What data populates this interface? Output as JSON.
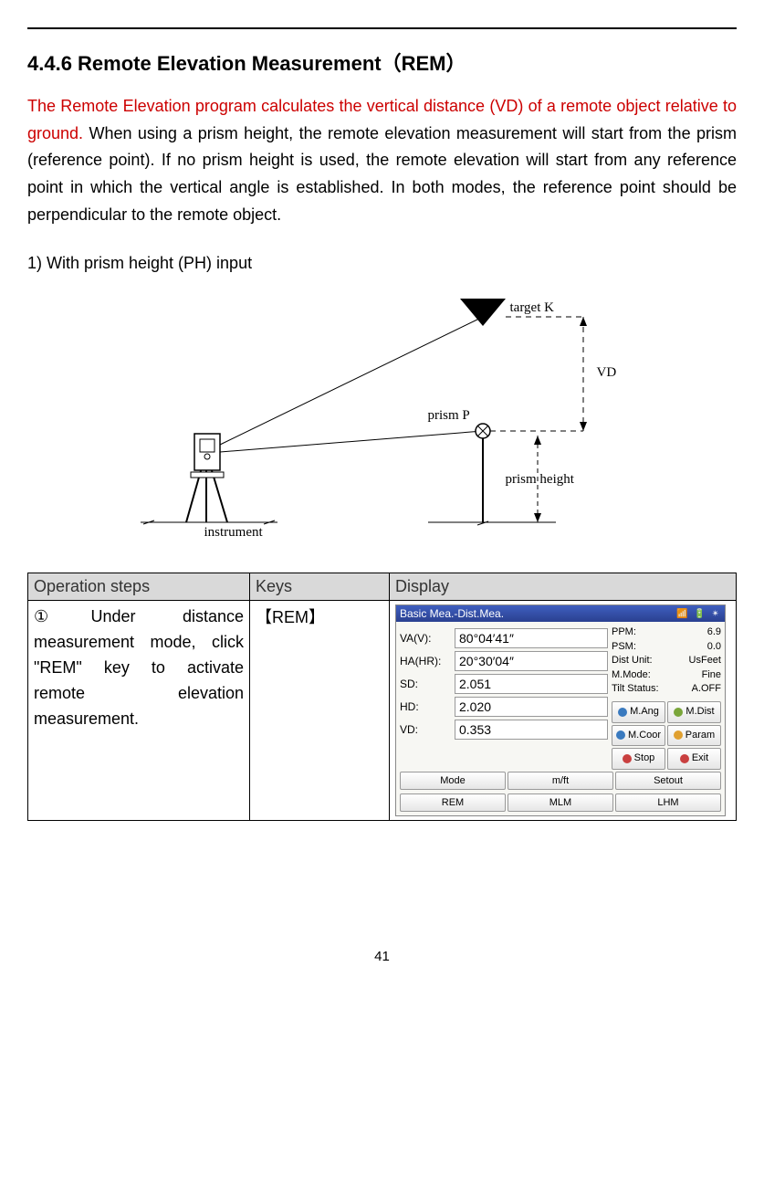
{
  "heading": "4.4.6 Remote Elevation Measurement（REM）",
  "intro_red": "The Remote Elevation program calculates the vertical distance (VD) of a remote object relative to ground. ",
  "intro_black": "When using a prism height, the remote elevation measurement will start from the prism (reference point). If no prism height is used, the remote elevation will start from any reference point in which the vertical angle is established. In both modes, the reference point should be perpendicular to the remote object.",
  "subhead": "1) With prism height (PH) input",
  "figure": {
    "target": "target K",
    "vd": "VD",
    "prism": "prism P",
    "prism_height": "prism height",
    "instrument": "instrument"
  },
  "table": {
    "headers": {
      "op": "Operation steps",
      "key": "Keys",
      "disp": "Display"
    },
    "row1": {
      "step": "①Under distance measurement mode, click \"REM\" key to activate remote elevation measurement.",
      "key": "【REM】"
    }
  },
  "device": {
    "title": "Basic Mea.-Dist.Mea.",
    "left": {
      "va_k": "VA(V):",
      "va_v": "80°04′41″",
      "ha_k": "HA(HR):",
      "ha_v": "20°30′04″",
      "sd_k": "SD:",
      "sd_v": "2.051",
      "hd_k": "HD:",
      "hd_v": "2.020",
      "vd_k": "VD:",
      "vd_v": "0.353"
    },
    "right": {
      "ppm_k": "PPM:",
      "ppm_v": "6.9",
      "psm_k": "PSM:",
      "psm_v": "0.0",
      "du_k": "Dist Unit:",
      "du_v": "UsFeet",
      "mm_k": "M.Mode:",
      "mm_v": "Fine",
      "ts_k": "Tilt Status:",
      "ts_v": "A.OFF"
    },
    "buttons": {
      "row1": [
        "Mode",
        "m/ft",
        "Setout"
      ],
      "row2": [
        "REM",
        "MLM",
        "LHM"
      ],
      "side1": [
        "M.Ang",
        "M.Dist"
      ],
      "side2": [
        "M.Coor",
        "Param"
      ],
      "side3": [
        "Stop",
        "Exit"
      ]
    }
  },
  "page_num": "41"
}
